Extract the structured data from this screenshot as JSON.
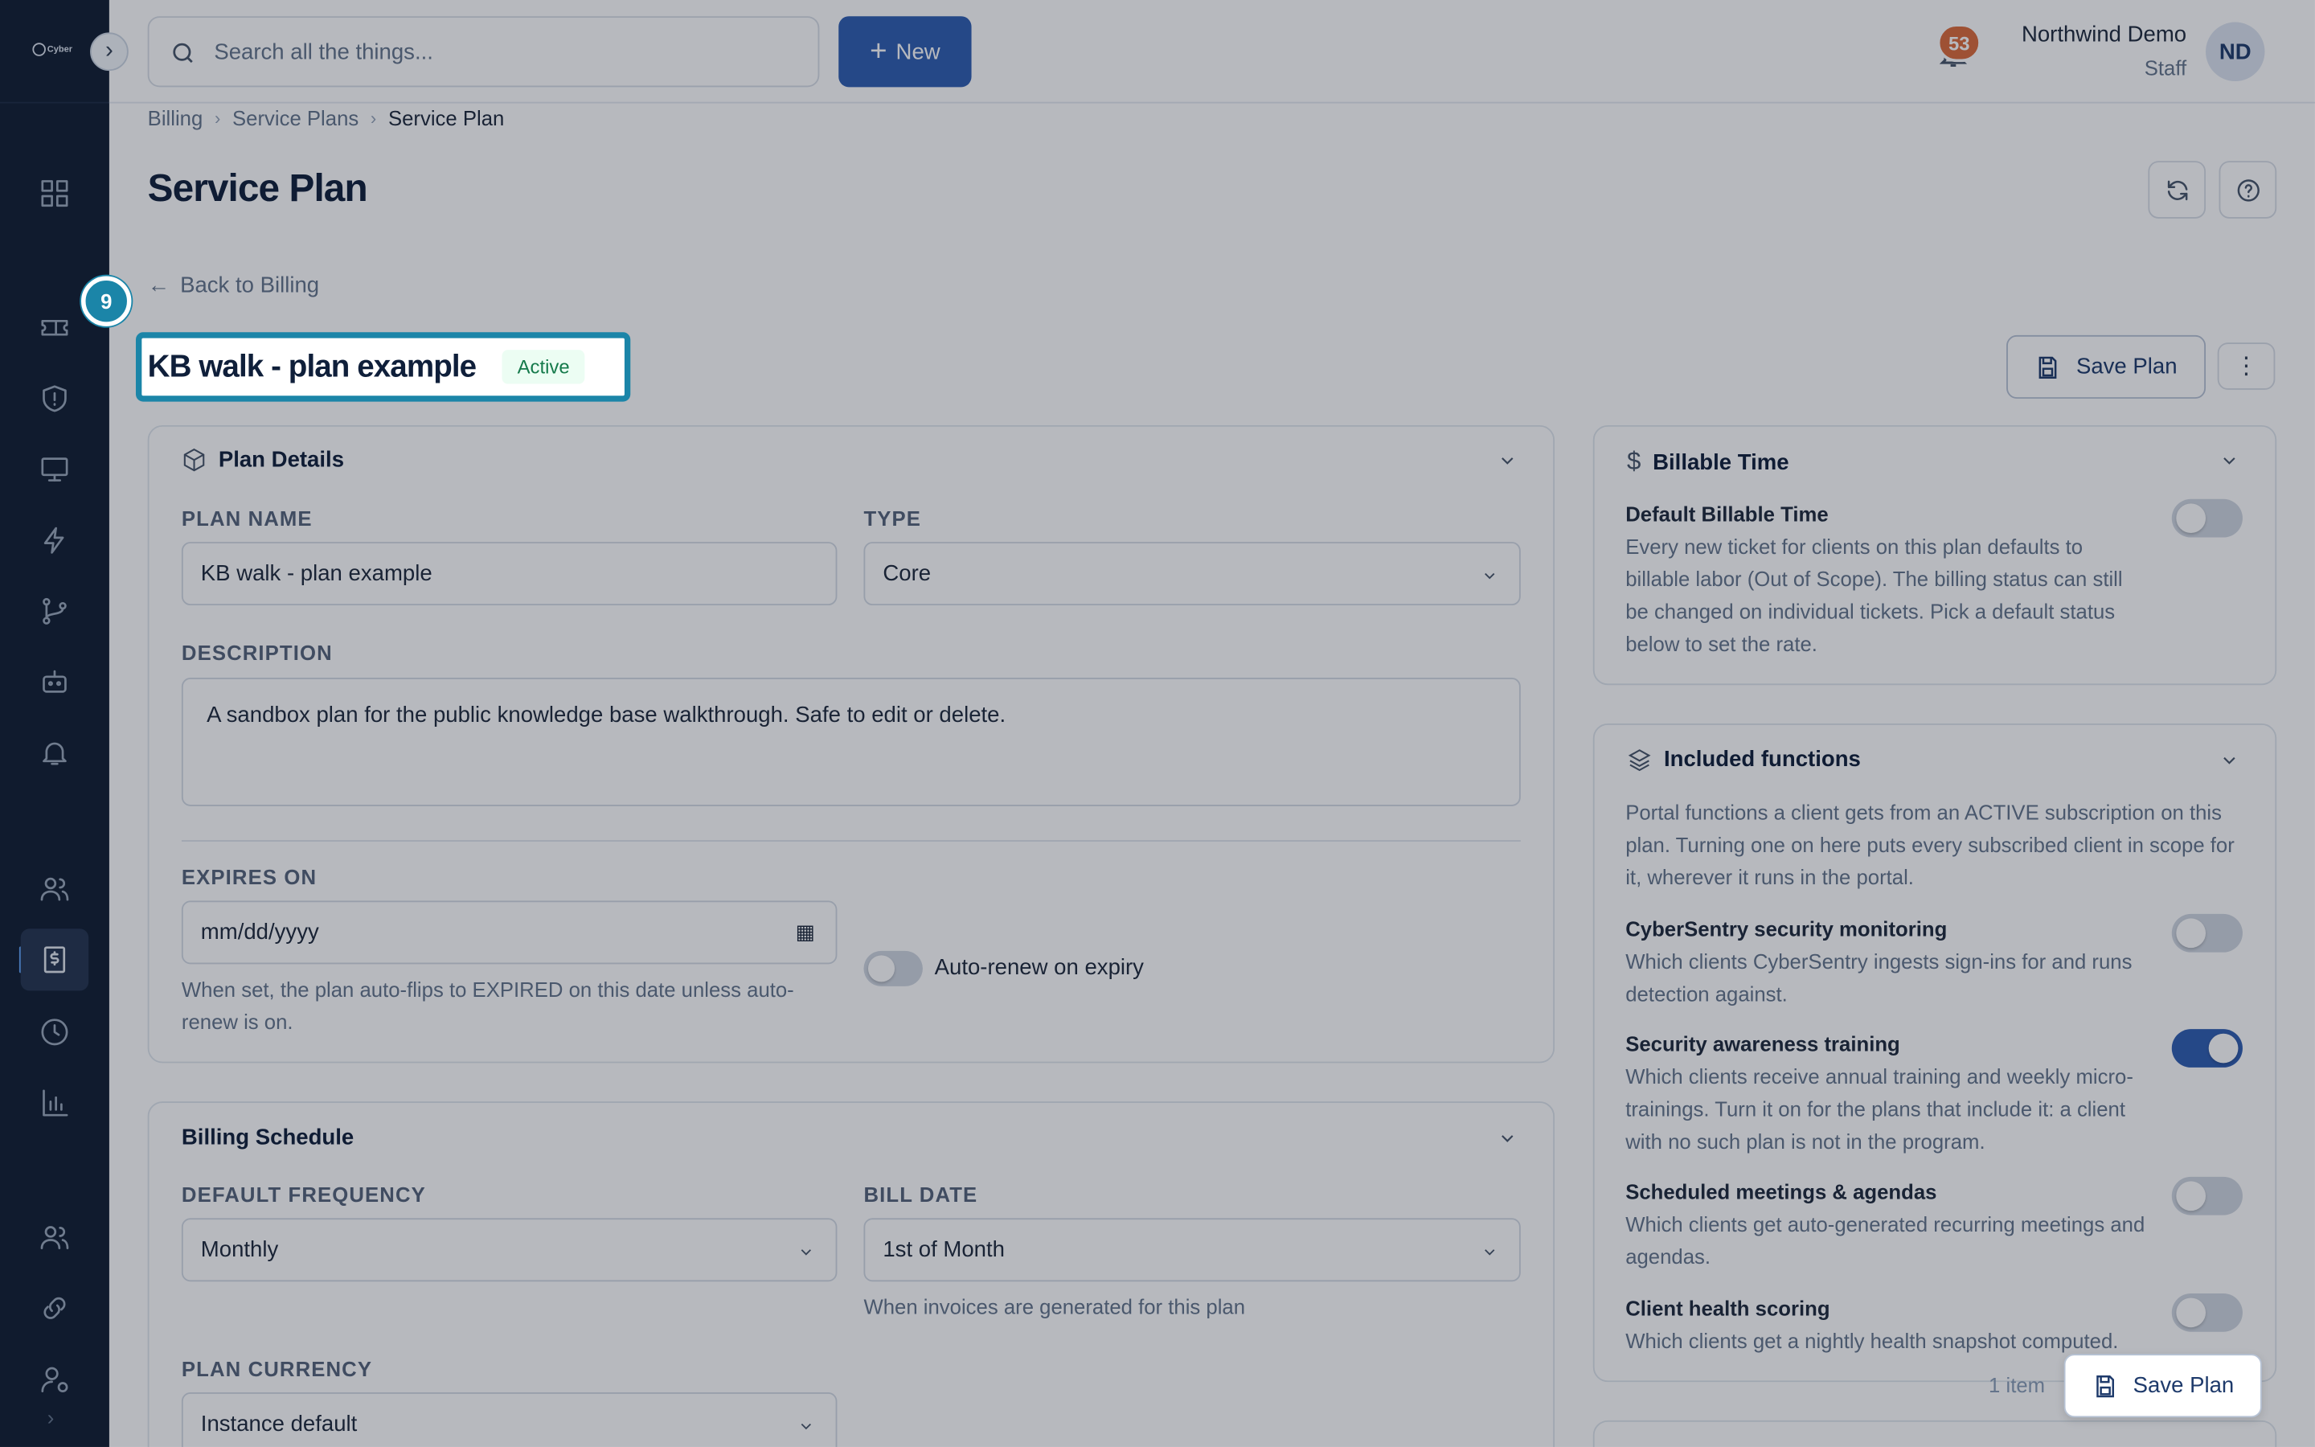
{
  "app": {
    "logo_text": "Cyber"
  },
  "topbar": {
    "search_placeholder": "Search all the things...",
    "new_label": "New",
    "notification_count": "53",
    "user_name": "Northwind Demo",
    "user_role": "Staff",
    "avatar_initials": "ND"
  },
  "breadcrumb": [
    "Billing",
    "Service Plans",
    "Service Plan"
  ],
  "page": {
    "title": "Service Plan",
    "back_label": "Back to Billing",
    "tour_step": "9",
    "plan_name": "KB walk - plan example",
    "status": "Active",
    "save_label": "Save Plan"
  },
  "plan_details": {
    "title": "Plan Details",
    "plan_name_label": "Plan name",
    "plan_name_value": "KB walk - plan example",
    "type_label": "Type",
    "type_value": "Core",
    "description_label": "Description",
    "description_value": "A sandbox plan for the public knowledge base walkthrough. Safe to edit or delete.",
    "expires_label": "Expires on",
    "expires_placeholder": "mm/dd/yyyy",
    "expires_help": "When set, the plan auto-flips to EXPIRED on this date unless auto-renew is on.",
    "auto_renew_label": "Auto-renew on expiry"
  },
  "billing_schedule": {
    "title": "Billing Schedule",
    "frequency_label": "Default frequency",
    "frequency_value": "Monthly",
    "bill_date_label": "Bill date",
    "bill_date_value": "1st of Month",
    "bill_date_help": "When invoices are generated for this plan",
    "currency_label": "Plan currency",
    "currency_value": "Instance default"
  },
  "billable_time": {
    "title": "Billable Time",
    "default_title": "Default Billable Time",
    "default_desc": "Every new ticket for clients on this plan defaults to billable labor (Out of Scope). The billing status can still be changed on individual tickets. Pick a default status below to set the rate."
  },
  "included_functions": {
    "title": "Included functions",
    "intro": "Portal functions a client gets from an ACTIVE subscription on this plan. Turning one on here puts every subscribed client in scope for it, wherever it runs in the portal.",
    "items": [
      {
        "title": "CyberSentry security monitoring",
        "desc": "Which clients CyberSentry ingests sign-ins for and runs detection against.",
        "on": false
      },
      {
        "title": "Security awareness training",
        "desc": "Which clients receive annual training and weekly micro-trainings. Turn it on for the plans that include it: a client with no such plan is not in the program.",
        "on": true
      },
      {
        "title": "Scheduled meetings & agendas",
        "desc": "Which clients get auto-generated recurring meetings and agendas.",
        "on": false
      },
      {
        "title": "Client health scoring",
        "desc": "Which clients get a nightly health snapshot computed.",
        "on": false
      }
    ]
  },
  "footer": {
    "items_count": "1 item",
    "save_label": "Save Plan"
  }
}
